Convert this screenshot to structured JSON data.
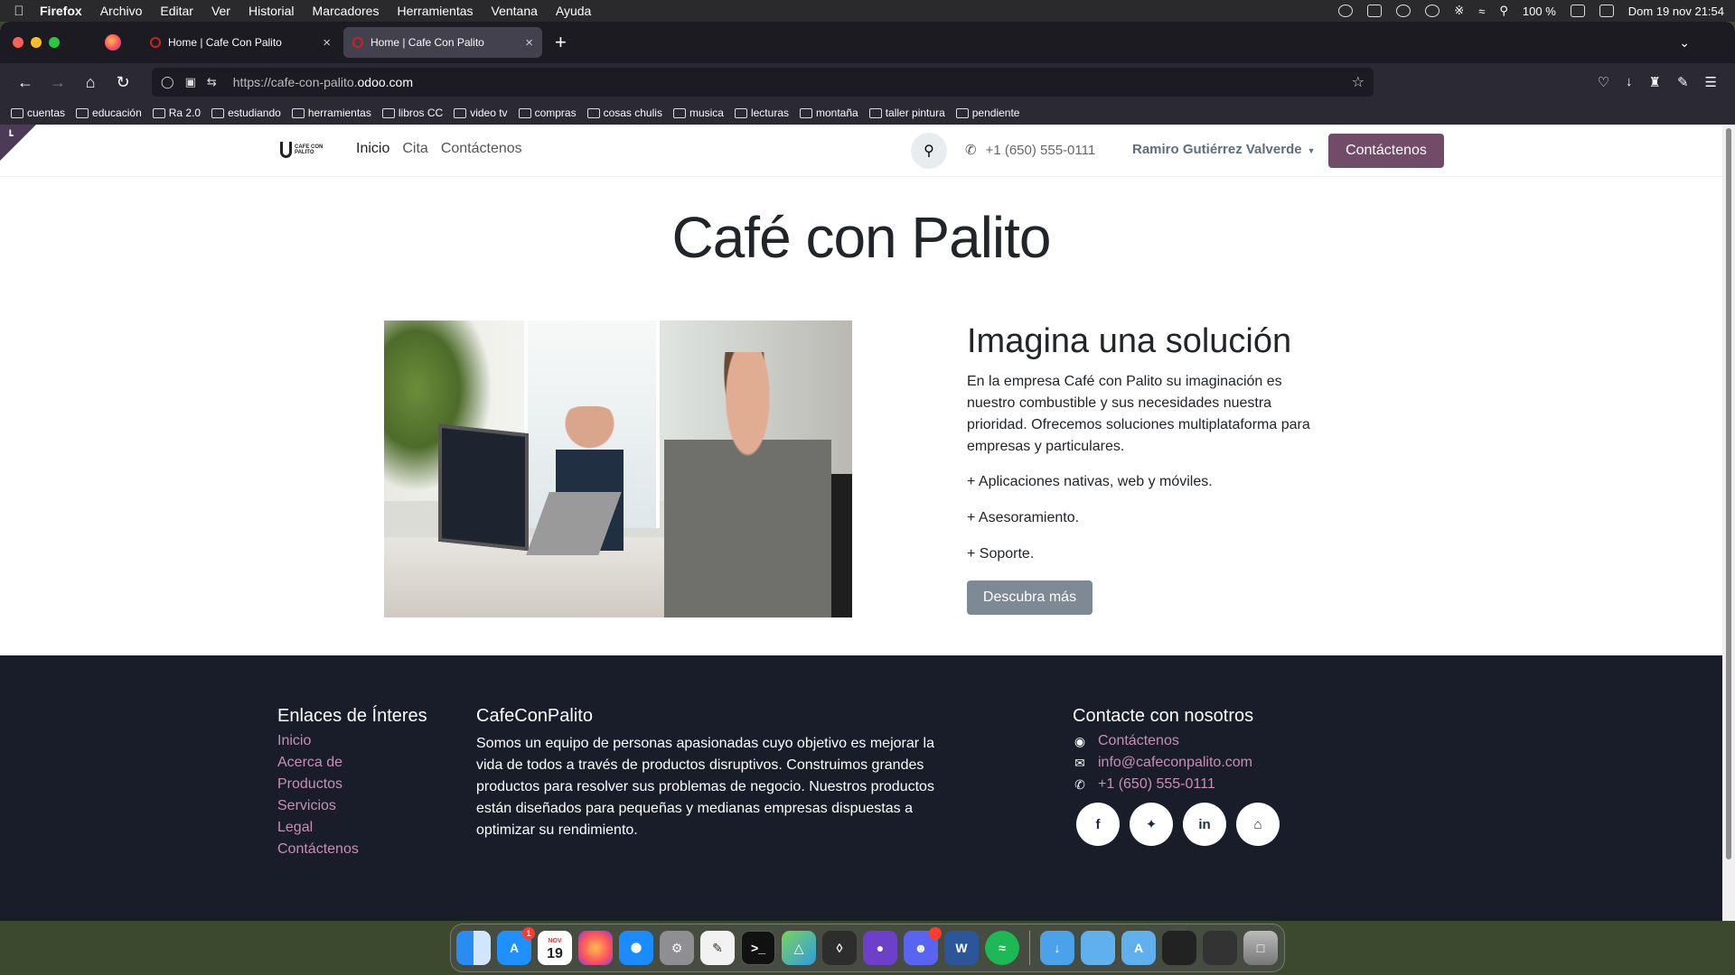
{
  "menubar": {
    "app": "Firefox",
    "items": [
      "Archivo",
      "Editar",
      "Ver",
      "Historial",
      "Marcadores",
      "Herramientas",
      "Ventana",
      "Ayuda"
    ],
    "battery": "100 %",
    "datetime": "Dom 19 nov  21:54"
  },
  "browser": {
    "tabs": [
      {
        "title": "Home | Cafe Con Palito",
        "active": false
      },
      {
        "title": "Home | Cafe Con Palito",
        "active": true
      }
    ],
    "url_prefix": "https://cafe-con-palito.",
    "url_domain": "odoo.com",
    "bookmarks": [
      "cuentas",
      "educación",
      "Ra 2.0",
      "estudiando",
      "herramientas",
      "libros CC",
      "video tv",
      "compras",
      "cosas chulis",
      "musica",
      "lecturas",
      "montaña",
      "taller pintura",
      "pendiente"
    ]
  },
  "site": {
    "logo_text": "CAFE CON PALITO",
    "nav": [
      "Inicio",
      "Cita",
      "Contáctenos"
    ],
    "phone": "+1 (650) 555-0111",
    "user": "Ramiro Gutiérrez Valverde",
    "cta": "Contáctenos",
    "hero_title": "Café con Palito",
    "solution": {
      "title": "Imagina una solución",
      "body": "En la empresa Café con Palito su imaginación es nuestro combustible y sus necesidades nuestra prioridad. Ofrecemos soluciones multiplataforma para empresas y particulares.",
      "items": [
        " + Aplicaciones nativas, web y móviles.",
        "+ Asesoramiento.",
        "+ Soporte."
      ],
      "button": "Descubra más"
    },
    "footer": {
      "links_title": "Enlaces de Ínteres",
      "links": [
        "Inicio",
        "Acerca de",
        "Productos",
        "Servicios",
        "Legal",
        "Contáctenos"
      ],
      "about_title": "CafeConPalito",
      "about_text": "Somos un equipo de personas apasionadas cuyo objetivo es mejorar la vida de todos a través de productos disruptivos. Construimos grandes productos para resolver sus problemas de negocio. Nuestros productos están diseñados para pequeñas y medianas empresas dispuestas a optimizar su rendimiento.",
      "contact_title": "Contacte con nosotros",
      "contact": [
        "Contáctenos",
        "info@cafeconpalito.com",
        "+1 (650) 555-0111"
      ],
      "social": [
        "f",
        "t",
        "in",
        "home"
      ]
    }
  },
  "dock": {
    "calendar_month": "NOV",
    "calendar_day": "19",
    "appstore_badge": "1"
  },
  "colors": {
    "brand": "#714b67",
    "footer_bg": "#191c29",
    "footer_link": "#c78fb8",
    "secondary_button": "#7d8a96"
  }
}
